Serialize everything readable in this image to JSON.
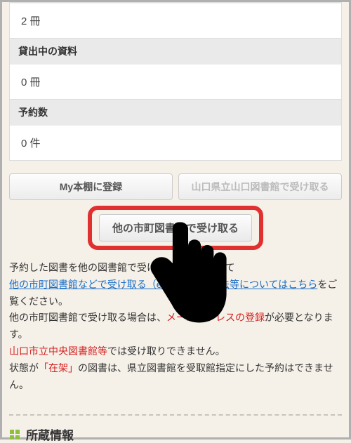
{
  "info": {
    "copies_value": "2 冊",
    "on_loan_label": "貸出中の資料",
    "on_loan_value": "0 冊",
    "reservations_label": "予約数",
    "reservations_value": "0 件"
  },
  "buttons": {
    "my_shelf": "My本棚に登録",
    "receive_prefectural": "山口県立山口図書館で受け取る",
    "receive_other": "他の市町図書館で受け取る"
  },
  "text": {
    "line1": "予約した図書を他の図書館で受け取る方法について",
    "link_text": "他の市町図書館などで受け取る（e-Net貸出）方法等についてはこちら",
    "line2_suffix": "をご覧ください。",
    "line3_prefix": "他の市町図書館で受け取る場合は、",
    "line3_red": "メールアドレスの登録",
    "line3_suffix": "が必要となります。",
    "line4_red": "山口市立中央図書館等",
    "line4_suffix": "では受け取りできません。",
    "line5_prefix": "状態が",
    "line5_red": "「在架」",
    "line5_suffix": "の図書は、県立図書館を受取館指定にした予約はできません。"
  },
  "section": {
    "holdings_title": "所蔵情報"
  }
}
